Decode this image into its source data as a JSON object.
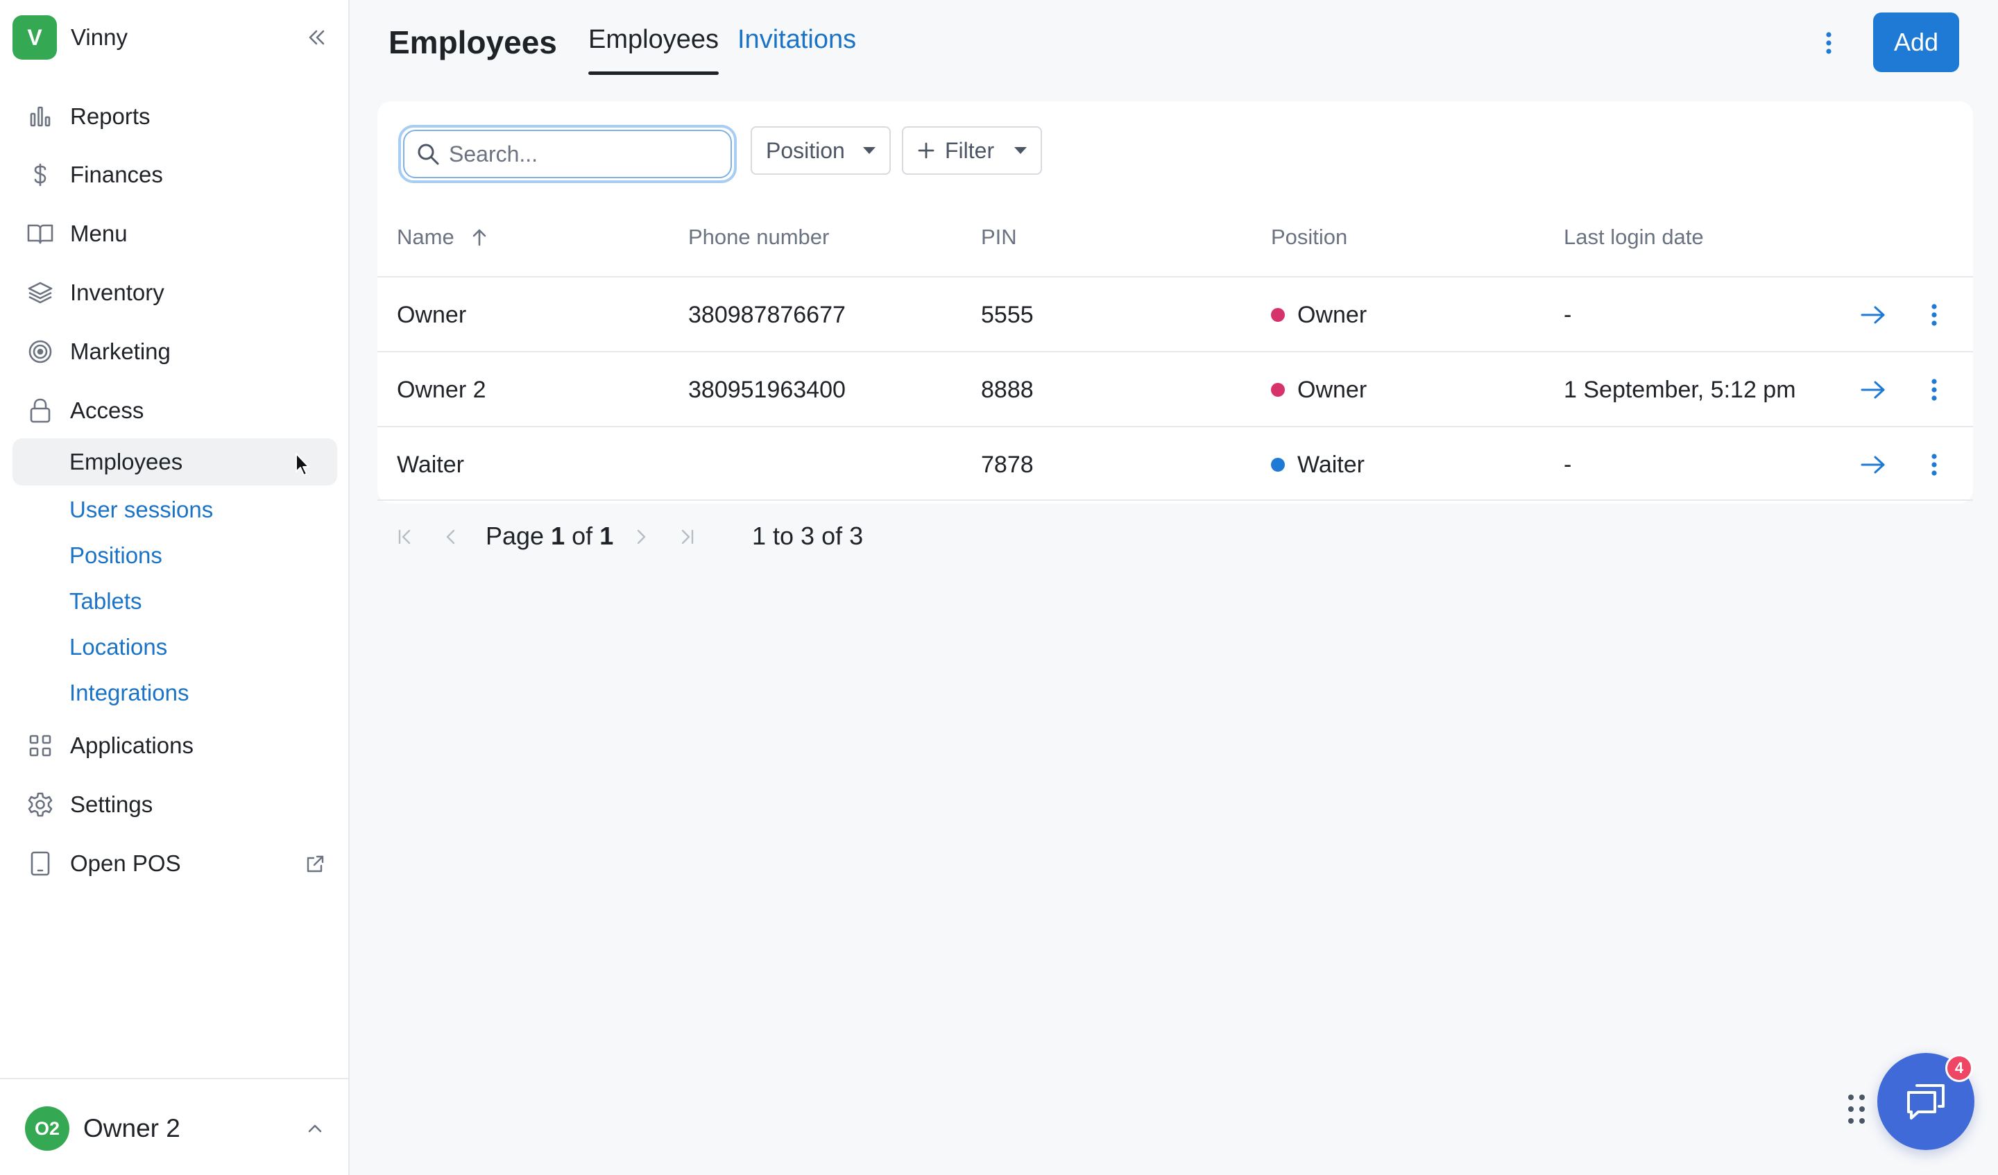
{
  "org": {
    "initial": "V",
    "name": "Vinny"
  },
  "sidebar": {
    "items": [
      {
        "label": "Reports",
        "icon": "bar-chart-icon"
      },
      {
        "label": "Finances",
        "icon": "dollar-icon"
      },
      {
        "label": "Menu",
        "icon": "book-icon"
      },
      {
        "label": "Inventory",
        "icon": "layers-icon"
      },
      {
        "label": "Marketing",
        "icon": "target-icon"
      },
      {
        "label": "Access",
        "icon": "lock-icon"
      }
    ],
    "access_sub": {
      "active": "Employees",
      "items": [
        "User sessions",
        "Positions",
        "Tablets",
        "Locations",
        "Integrations"
      ]
    },
    "bottom_items": [
      {
        "label": "Applications",
        "icon": "grid-icon"
      },
      {
        "label": "Settings",
        "icon": "gear-icon"
      },
      {
        "label": "Open POS",
        "icon": "tablet-icon"
      }
    ]
  },
  "user": {
    "initials": "O2",
    "name": "Owner 2"
  },
  "header": {
    "title": "Employees",
    "tabs": [
      "Employees",
      "Invitations"
    ],
    "add_label": "Add"
  },
  "toolbar": {
    "search_placeholder": "Search...",
    "position_label": "Position",
    "filter_label": "Filter"
  },
  "table": {
    "columns": [
      "Name",
      "Phone number",
      "PIN",
      "Position",
      "Last login date"
    ],
    "rows": [
      {
        "name": "Owner",
        "phone": "380987876677",
        "pin": "5555",
        "position": "Owner",
        "last_login": "-"
      },
      {
        "name": "Owner 2",
        "phone": "380951963400",
        "pin": "8888",
        "position": "Owner",
        "last_login": "1 September, 5:12 pm"
      },
      {
        "name": "Waiter",
        "phone": "",
        "pin": "7878",
        "position": "Waiter",
        "last_login": "-"
      }
    ]
  },
  "pagination": {
    "page_word": "Page",
    "current": "1",
    "of_word": "of",
    "total": "1",
    "range": "1 to 3 of 3"
  },
  "chat": {
    "badge": "4"
  },
  "colors": {
    "accent": "#1f7ad6",
    "link": "#1a73c7",
    "owner_dot": "#d6336c",
    "waiter_dot": "#1f7ad6",
    "brand_green": "#34a853"
  }
}
